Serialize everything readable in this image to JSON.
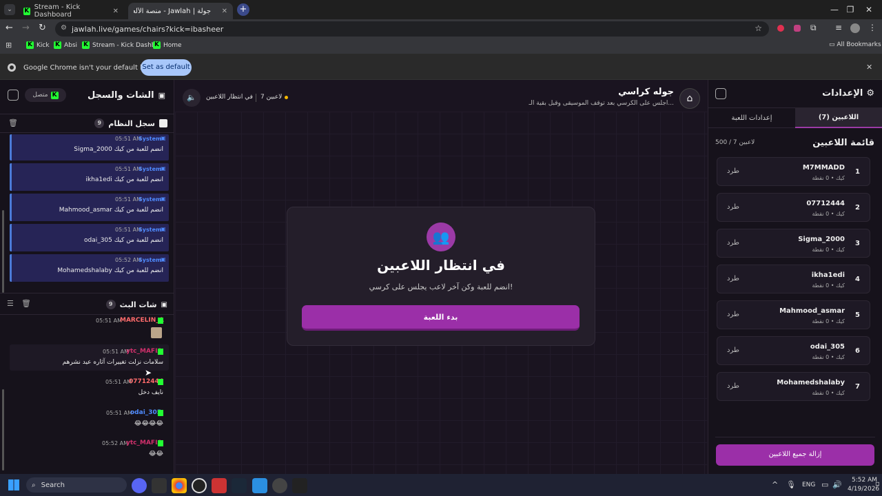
{
  "browser": {
    "tabs": [
      {
        "title": "Stream - Kick Dashboard"
      },
      {
        "title": "جولة | Jawlah - منصة الألعاب الت..."
      }
    ],
    "url": "jawlah.live/games/chairs?kick=ibasheer",
    "bookmarks": [
      "Kick",
      "Absi",
      "Stream - Kick Dashb...",
      "Home"
    ],
    "all_bookmarks": "All Bookmarks",
    "infobar_text": "Google Chrome isn't your default browser",
    "infobar_button": "Set as default"
  },
  "chat_panel": {
    "title": "الشات والسجل",
    "status": "متصل",
    "system_log": {
      "title": "سجل النظام",
      "count": "9",
      "messages": [
        {
          "name": "System",
          "time": "05:51 AM",
          "text": "Sigma_2000 انضم للعبة من كيك"
        },
        {
          "name": "System",
          "time": "05:51 AM",
          "text": "ikha1edi انضم للعبة من كيك"
        },
        {
          "name": "System",
          "time": "05:51 AM",
          "text": "Mahmood_asmar انضم للعبة من كيك"
        },
        {
          "name": "System",
          "time": "05:51 AM",
          "text": "odai_305 انضم للعبة من كيك"
        },
        {
          "name": "System",
          "time": "05:52 AM",
          "text": "Mohamedshalaby انضم للعبة من كيك"
        }
      ]
    },
    "live_chat": {
      "title": "شات البث",
      "count": "9",
      "messages": [
        {
          "name": "MARCELIN_A",
          "time": "05:51 AM",
          "text": "",
          "color": "#ff6b6b"
        },
        {
          "name": "ytc_MAFIA",
          "time": "05:51 AM",
          "text": "سلامات نزلت تغييرات آثاره عيد نشرهم",
          "color": "#d0306b"
        },
        {
          "name": "07712444",
          "time": "05:51 AM",
          "text": "نايف دخل",
          "color": "#ff6b6b"
        },
        {
          "name": "odai_305",
          "time": "05:51 AM",
          "text": "😂😂😂😂",
          "color": "#4f8bff"
        },
        {
          "name": "ytc_MAFIA",
          "time": "05:52 AM",
          "text": "😂😂",
          "color": "#d0306b"
        }
      ]
    }
  },
  "game": {
    "title": "جوله كراسي",
    "subtitle": "اجلس على الكرسي بعد توقف الموسيقى وقبل بقية الـ...",
    "players_count": "7 لاعبين",
    "status": "في انتظار اللاعبين",
    "waiting_title": "في انتظار اللاعبين",
    "waiting_subtitle": "انضم للعبة وكن آخر لاعب يجلس على كرسي!",
    "start_button": "بدء اللعبة"
  },
  "settings": {
    "title": "الإعدادات",
    "tabs": [
      "اللاعبين (7)",
      "إعدادات اللعبة"
    ],
    "list_title": "قائمة اللاعبين",
    "capacity": "500 / 7 لاعبين",
    "kick_label": "طرد",
    "players": [
      {
        "num": "1",
        "name": "M7MMADD",
        "meta": "كيك • 0 نقطة"
      },
      {
        "num": "2",
        "name": "07712444",
        "meta": "كيك • 0 نقطة"
      },
      {
        "num": "3",
        "name": "Sigma_2000",
        "meta": "كيك • 0 نقطة"
      },
      {
        "num": "4",
        "name": "ikha1edi",
        "meta": "كيك • 0 نقطة"
      },
      {
        "num": "5",
        "name": "Mahmood_asmar",
        "meta": "كيك • 0 نقطة"
      },
      {
        "num": "6",
        "name": "odai_305",
        "meta": "كيك • 0 نقطة"
      },
      {
        "num": "7",
        "name": "Mohamedshalaby",
        "meta": "كيك • 0 نقطة"
      }
    ],
    "remove_all": "إزالة جميع اللاعبين"
  },
  "taskbar": {
    "search": "Search",
    "lang": "ENG",
    "time": "5:52 AM",
    "date": "4/19/2026"
  }
}
